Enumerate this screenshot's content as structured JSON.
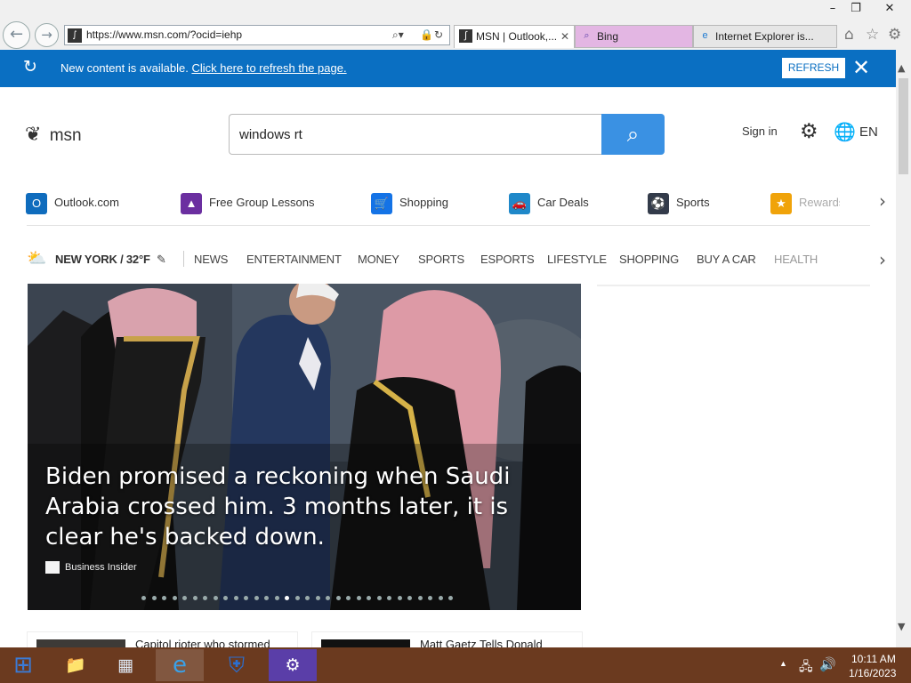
{
  "browser": {
    "url": "https://www.msn.com/?ocid=iehp",
    "tabs": [
      {
        "label": "MSN | Outlook,...",
        "icon": "msn-icon",
        "active": true
      },
      {
        "label": "Bing",
        "icon": "bing-search-icon",
        "active": false
      },
      {
        "label": "Internet Explorer is...",
        "icon": "ie-icon",
        "active": false
      }
    ],
    "window_controls": {
      "minimize": "–",
      "restore": "❐",
      "close": "✕"
    }
  },
  "banner": {
    "message": "New content is available.",
    "link": "Click here to refresh the page.",
    "refresh_button": "REFRESH",
    "close": "✕"
  },
  "header": {
    "logo_text": "msn",
    "search_value": "windows rt",
    "sign_in": "Sign in",
    "language": "EN"
  },
  "quick_links": [
    {
      "label": "Outlook.com",
      "icon": "outlook-icon",
      "color": "#0f6cbd"
    },
    {
      "label": "Free Group Lessons",
      "icon": "graduation-cap-icon",
      "color": "#6b2fa0"
    },
    {
      "label": "Shopping",
      "icon": "shopping-cart-icon",
      "color": "#1473e6"
    },
    {
      "label": "Car Deals",
      "icon": "car-icon",
      "color": "#1f88c9"
    },
    {
      "label": "Sports",
      "icon": "sports-ball-icon",
      "color": "#333b4a"
    },
    {
      "label": "Rewards",
      "icon": "medal-icon",
      "color": "#f0a30a"
    }
  ],
  "weather": {
    "label": "NEW YORK / 32°F"
  },
  "nav": [
    "NEWS",
    "ENTERTAINMENT",
    "MONEY",
    "SPORTS",
    "ESPORTS",
    "LIFESTYLE",
    "SHOPPING",
    "BUY A CAR",
    "HEALTH"
  ],
  "hero": {
    "headline": "Biden promised a reckoning when Saudi Arabia crossed him. 3 months later, it is clear he's backed down.",
    "source": "Business Insider",
    "slides_total": 31,
    "slide_active": 14
  },
  "cards": [
    {
      "title": "Capitol rioter who stormed"
    },
    {
      "title": "Matt Gaetz Tells Donald"
    }
  ],
  "taskbar": {
    "apps": [
      "start-icon",
      "file-explorer-icon",
      "server-manager-icon",
      "internet-explorer-icon",
      "security-shield-icon",
      "settings-gear-icon"
    ],
    "time": "10:11 AM",
    "date": "1/16/2023"
  }
}
